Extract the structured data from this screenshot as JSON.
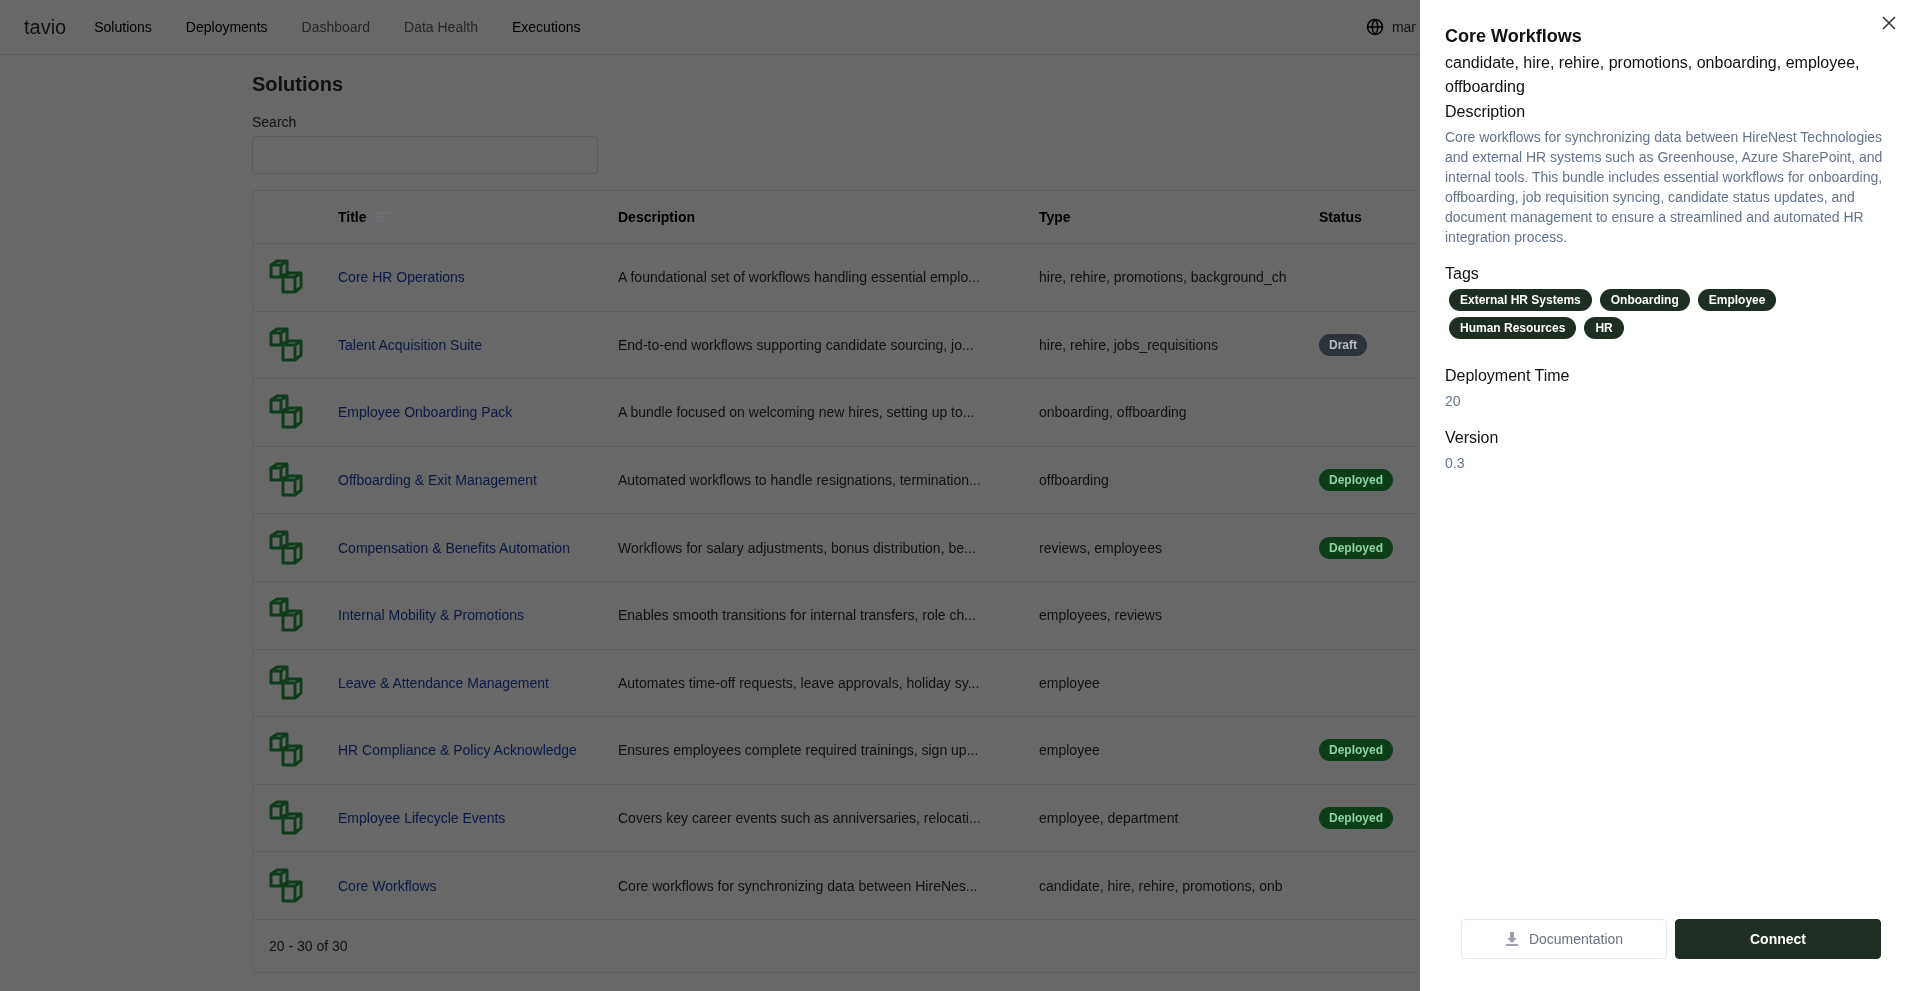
{
  "nav": {
    "logo": "tavio",
    "items": [
      {
        "label": "Solutions",
        "disabled": false
      },
      {
        "label": "Deployments",
        "disabled": false
      },
      {
        "label": "Dashboard",
        "disabled": true
      },
      {
        "label": "Data Health",
        "disabled": true
      },
      {
        "label": "Executions",
        "disabled": false
      }
    ],
    "user": "mar"
  },
  "page": {
    "title": "Solutions",
    "search": {
      "label": "Search"
    }
  },
  "table": {
    "columns": [
      "Title",
      "Description",
      "Type",
      "Status"
    ],
    "rows": [
      {
        "title": "Core HR Operations",
        "description": "A foundational set of workflows handling essential emplo...",
        "type": "hire, rehire, promotions, background_ch"
      },
      {
        "title": "Talent Acquisition Suite",
        "description": "End-to-end workflows supporting candidate sourcing, jo...",
        "type": "hire, rehire, jobs_requisitions",
        "status": {
          "label": "Draft",
          "kind": "draft"
        }
      },
      {
        "title": "Employee Onboarding Pack",
        "description": "A bundle focused on welcoming new hires, setting up to...",
        "type": "onboarding, offboarding"
      },
      {
        "title": "Offboarding & Exit Management",
        "description": "Automated workflows to handle resignations, termination...",
        "type": "offboarding",
        "status": {
          "label": "Deployed",
          "kind": "deployed"
        }
      },
      {
        "title": "Compensation & Benefits Automation",
        "description": "Workflows for salary adjustments, bonus distribution, be...",
        "type": "reviews, employees",
        "status": {
          "label": "Deployed",
          "kind": "deployed"
        }
      },
      {
        "title": "Internal Mobility & Promotions",
        "description": "Enables smooth transitions for internal transfers, role ch...",
        "type": "employees, reviews"
      },
      {
        "title": "Leave & Attendance Management",
        "description": "Automates time-off requests, leave approvals, holiday sy...",
        "type": "employee"
      },
      {
        "title": "HR Compliance & Policy Acknowledge",
        "description": "Ensures employees complete required trainings, sign up...",
        "type": "employee",
        "status": {
          "label": "Deployed",
          "kind": "deployed"
        }
      },
      {
        "title": "Employee Lifecycle Events",
        "description": "Covers key career events such as anniversaries, relocati...",
        "type": "employee, department",
        "status": {
          "label": "Deployed",
          "kind": "deployed"
        }
      },
      {
        "title": "Core Workflows",
        "description": "Core workflows for synchronizing data between HireNes...",
        "type": "candidate, hire, rehire, promotions, onb"
      }
    ],
    "pagination": "20 - 30 of 30"
  },
  "drawer": {
    "title": "Core Workflows",
    "subtitle": "candidate, hire, rehire, promotions, onboarding, employee, offboarding",
    "sections": [
      {
        "heading": "Description",
        "kind": "text",
        "text": "Core workflows for synchronizing data between HireNest Technologies and external HR systems such as Greenhouse, Azure SharePoint, and internal tools. This bundle includes essential workflows for onboarding, offboarding, job requisition syncing, candidate status updates, and document management to ensure a streamlined and automated HR integration process."
      },
      {
        "heading": "Tags",
        "kind": "tags",
        "tags": [
          "External HR Systems",
          "Onboarding",
          "Employee",
          "Human Resources",
          "HR"
        ]
      },
      {
        "heading": "Deployment Time",
        "kind": "text",
        "text": "20"
      },
      {
        "heading": "Version",
        "kind": "text",
        "text": "0.3"
      }
    ],
    "buttons": [
      {
        "label": "Documentation",
        "kind": "secondary"
      },
      {
        "label": "Connect",
        "kind": "primary"
      }
    ]
  }
}
